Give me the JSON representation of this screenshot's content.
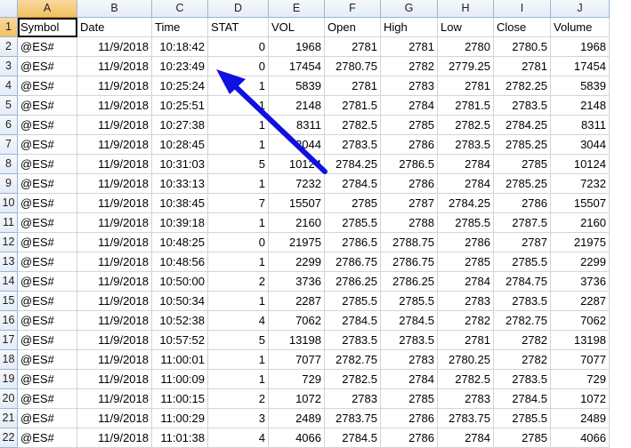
{
  "columns": [
    {
      "letter": "A"
    },
    {
      "letter": "B"
    },
    {
      "letter": "C"
    },
    {
      "letter": "D"
    },
    {
      "letter": "E"
    },
    {
      "letter": "F"
    },
    {
      "letter": "G"
    },
    {
      "letter": "H"
    },
    {
      "letter": "I"
    },
    {
      "letter": "J"
    }
  ],
  "header_row": {
    "row_number": "1",
    "cells": [
      "Symbol",
      "Date",
      "Time",
      "STAT",
      "VOL",
      "Open",
      "High",
      "Low",
      "Close",
      "Volume"
    ]
  },
  "rows": [
    {
      "n": "2",
      "cells": [
        "@ES#",
        "11/9/2018",
        "10:18:42",
        "0",
        "1968",
        "2781",
        "2781",
        "2780",
        "2780.5",
        "1968"
      ]
    },
    {
      "n": "3",
      "cells": [
        "@ES#",
        "11/9/2018",
        "10:23:49",
        "0",
        "17454",
        "2780.75",
        "2782",
        "2779.25",
        "2781",
        "17454"
      ]
    },
    {
      "n": "4",
      "cells": [
        "@ES#",
        "11/9/2018",
        "10:25:24",
        "1",
        "5839",
        "2781",
        "2783",
        "2781",
        "2782.25",
        "5839"
      ]
    },
    {
      "n": "5",
      "cells": [
        "@ES#",
        "11/9/2018",
        "10:25:51",
        "1",
        "2148",
        "2781.5",
        "2784",
        "2781.5",
        "2783.5",
        "2148"
      ]
    },
    {
      "n": "6",
      "cells": [
        "@ES#",
        "11/9/2018",
        "10:27:38",
        "1",
        "8311",
        "2782.5",
        "2785",
        "2782.5",
        "2784.25",
        "8311"
      ]
    },
    {
      "n": "7",
      "cells": [
        "@ES#",
        "11/9/2018",
        "10:28:45",
        "1",
        "3044",
        "2783.5",
        "2786",
        "2783.5",
        "2785.25",
        "3044"
      ]
    },
    {
      "n": "8",
      "cells": [
        "@ES#",
        "11/9/2018",
        "10:31:03",
        "5",
        "10124",
        "2784.25",
        "2786.5",
        "2784",
        "2785",
        "10124"
      ]
    },
    {
      "n": "9",
      "cells": [
        "@ES#",
        "11/9/2018",
        "10:33:13",
        "1",
        "7232",
        "2784.5",
        "2786",
        "2784",
        "2785.25",
        "7232"
      ]
    },
    {
      "n": "10",
      "cells": [
        "@ES#",
        "11/9/2018",
        "10:38:45",
        "7",
        "15507",
        "2785",
        "2787",
        "2784.25",
        "2786",
        "15507"
      ]
    },
    {
      "n": "11",
      "cells": [
        "@ES#",
        "11/9/2018",
        "10:39:18",
        "1",
        "2160",
        "2785.5",
        "2788",
        "2785.5",
        "2787.5",
        "2160"
      ]
    },
    {
      "n": "12",
      "cells": [
        "@ES#",
        "11/9/2018",
        "10:48:25",
        "0",
        "21975",
        "2786.5",
        "2788.75",
        "2786",
        "2787",
        "21975"
      ]
    },
    {
      "n": "13",
      "cells": [
        "@ES#",
        "11/9/2018",
        "10:48:56",
        "1",
        "2299",
        "2786.75",
        "2786.75",
        "2785",
        "2785.5",
        "2299"
      ]
    },
    {
      "n": "14",
      "cells": [
        "@ES#",
        "11/9/2018",
        "10:50:00",
        "2",
        "3736",
        "2786.25",
        "2786.25",
        "2784",
        "2784.75",
        "3736"
      ]
    },
    {
      "n": "15",
      "cells": [
        "@ES#",
        "11/9/2018",
        "10:50:34",
        "1",
        "2287",
        "2785.5",
        "2785.5",
        "2783",
        "2783.5",
        "2287"
      ]
    },
    {
      "n": "16",
      "cells": [
        "@ES#",
        "11/9/2018",
        "10:52:38",
        "4",
        "7062",
        "2784.5",
        "2784.5",
        "2782",
        "2782.75",
        "7062"
      ]
    },
    {
      "n": "17",
      "cells": [
        "@ES#",
        "11/9/2018",
        "10:57:52",
        "5",
        "13198",
        "2783.5",
        "2783.5",
        "2781",
        "2782",
        "13198"
      ]
    },
    {
      "n": "18",
      "cells": [
        "@ES#",
        "11/9/2018",
        "11:00:01",
        "1",
        "7077",
        "2782.75",
        "2783",
        "2780.25",
        "2782",
        "7077"
      ]
    },
    {
      "n": "19",
      "cells": [
        "@ES#",
        "11/9/2018",
        "11:00:09",
        "1",
        "729",
        "2782.5",
        "2784",
        "2782.5",
        "2783.5",
        "729"
      ]
    },
    {
      "n": "20",
      "cells": [
        "@ES#",
        "11/9/2018",
        "11:00:15",
        "2",
        "1072",
        "2783",
        "2785",
        "2783",
        "2784.5",
        "1072"
      ]
    },
    {
      "n": "21",
      "cells": [
        "@ES#",
        "11/9/2018",
        "11:00:29",
        "3",
        "2489",
        "2783.75",
        "2786",
        "2783.75",
        "2785.5",
        "2489"
      ]
    },
    {
      "n": "22",
      "cells": [
        "@ES#",
        "11/9/2018",
        "11:01:38",
        "4",
        "4066",
        "2784.5",
        "2786",
        "2784",
        "2785",
        "4066"
      ]
    }
  ],
  "selection": {
    "active_column": "A",
    "active_row": "1"
  },
  "colors": {
    "arrow": "#1010e0",
    "gridline": "#d4d4d4",
    "header_border": "#9eb6ce",
    "active_header": "#f1c15f"
  },
  "annotation": {
    "shape": "arrow",
    "target_cell": "C3"
  }
}
